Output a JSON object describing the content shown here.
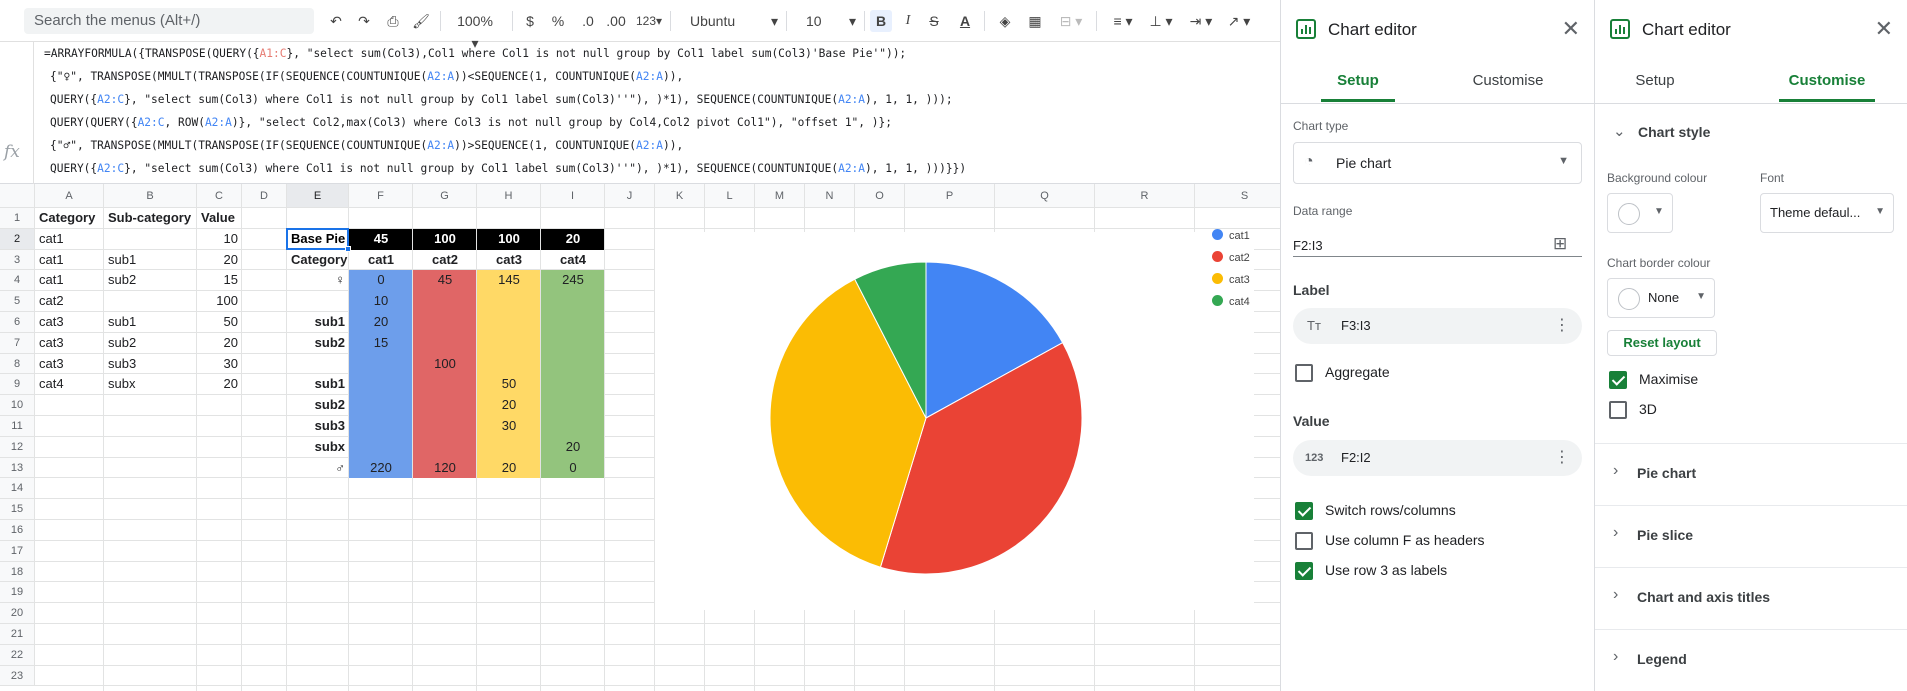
{
  "toolbar": {
    "search_placeholder": "Search the menus (Alt+/)",
    "zoom": "100%",
    "currency": "$",
    "percent": "%",
    "dec_less": ".0",
    "dec_more": ".00",
    "more_formats": "123",
    "font": "Ubuntu",
    "font_size": "10"
  },
  "formula": {
    "line1_a": "=ARRAYFORMULA({TRANSPOSE(QUERY({",
    "line1_ref": "A1:C",
    "line1_b": "}, \"select sum(Col3),Col1 where Col1 is not null group by Col1 label sum(Col3)'Base Pie'\"));",
    "line2_a": "{\"",
    "line2_sym": "♀",
    "line2_b": "\", TRANSPOSE(MMULT(TRANSPOSE(IF(SEQUENCE(COUNTUNIQUE(",
    "line2_ref1": "A2:A",
    "line2_c": "))<SEQUENCE(1, COUNTUNIQUE(",
    "line2_ref2": "A2:A",
    "line2_d": ")),",
    "line3_a": "QUERY({",
    "line3_ref": "A2:C",
    "line3_b": "}, \"select sum(Col3) where Col1 is not null group by Col1 label sum(Col3)''\"), )*1), SEQUENCE(COUNTUNIQUE(",
    "line3_ref2": "A2:A",
    "line3_c": "), 1, 1, )));",
    "line4_a": "QUERY(QUERY({",
    "line4_ref": "A2:C",
    "line4_b": ", ROW(",
    "line4_ref2": "A2:A",
    "line4_c": ")}, \"select Col2,max(Col3) where Col3 is not null group by Col4,Col2 pivot Col1\"), \"offset 1\", )};",
    "line5_a": "{\"",
    "line5_sym": "♂",
    "line5_b": "\", TRANSPOSE(MMULT(TRANSPOSE(IF(SEQUENCE(COUNTUNIQUE(",
    "line5_ref1": "A2:A",
    "line5_c": "))>SEQUENCE(1, COUNTUNIQUE(",
    "line5_ref2": "A2:A",
    "line5_d": ")),",
    "line6_a": "QUERY({",
    "line6_ref": "A2:C",
    "line6_b": "}, \"select sum(Col3) where Col1 is not null group by Col1 label sum(Col3)''\"), )*1), SEQUENCE(COUNTUNIQUE(",
    "line6_ref2": "A2:A",
    "line6_c": "), 1, 1, )))}})"
  },
  "grid": {
    "columns": [
      "A",
      "B",
      "C",
      "D",
      "E",
      "F",
      "G",
      "H",
      "I",
      "J",
      "K",
      "L",
      "M",
      "N",
      "O",
      "P",
      "Q",
      "R",
      "S"
    ],
    "rows": [
      "1",
      "2",
      "3",
      "4",
      "5",
      "6",
      "7",
      "8",
      "9",
      "10",
      "11",
      "12",
      "13",
      "14",
      "15",
      "16",
      "17",
      "18",
      "19",
      "20",
      "21",
      "22",
      "23"
    ],
    "a": [
      "Category",
      "cat1",
      "cat1",
      "cat1",
      "cat2",
      "cat3",
      "cat3",
      "cat3",
      "cat4"
    ],
    "b": [
      "Sub-category",
      "",
      "sub1",
      "sub2",
      "",
      "sub1",
      "sub2",
      "sub3",
      "subx"
    ],
    "c": [
      "Value",
      "10",
      "20",
      "15",
      "100",
      "50",
      "20",
      "30",
      "20"
    ],
    "e": [
      "Base Pie",
      "Category",
      "♀",
      "",
      "sub1",
      "sub2",
      "",
      "sub1",
      "sub2",
      "sub3",
      "subx",
      "♂"
    ],
    "f": [
      "45",
      "cat1",
      "0",
      "10",
      "20",
      "15",
      "",
      "",
      "",
      "",
      "",
      "220"
    ],
    "g": [
      "100",
      "cat2",
      "45",
      "",
      "",
      "",
      "100",
      "",
      "",
      "",
      "",
      "120"
    ],
    "h": [
      "100",
      "cat3",
      "145",
      "",
      "",
      "",
      "",
      "50",
      "20",
      "30",
      "",
      "20"
    ],
    "i": [
      "20",
      "cat4",
      "245",
      "",
      "",
      "",
      "",
      "",
      "",
      "",
      "20",
      "0"
    ]
  },
  "colors": {
    "blue": "#4285f4",
    "red": "#ea4335",
    "yellow": "#fbbc04",
    "green": "#34a853",
    "accent": "#188038"
  },
  "chart_data": {
    "type": "pie",
    "categories": [
      "cat1",
      "cat2",
      "cat3",
      "cat4"
    ],
    "values": [
      45,
      100,
      100,
      20
    ],
    "legend_position": "right"
  },
  "editor_setup": {
    "title": "Chart editor",
    "tab_setup": "Setup",
    "tab_customise": "Customise",
    "chart_type_label": "Chart type",
    "chart_type_value": "Pie chart",
    "data_range_label": "Data range",
    "data_range_value": "F2:I3",
    "label_section": "Label",
    "label_value": "F3:I3",
    "aggregate": "Aggregate",
    "value_section": "Value",
    "value_value": "F2:I2",
    "switch_rows": "Switch rows/columns",
    "use_col_headers": "Use column F as headers",
    "use_row_labels": "Use row 3 as labels"
  },
  "editor_customise": {
    "title": "Chart editor",
    "tab_setup": "Setup",
    "tab_customise": "Customise",
    "chart_style": "Chart style",
    "bg_colour_label": "Background colour",
    "font_label": "Font",
    "font_value": "Theme defaul...",
    "border_colour_label": "Chart border colour",
    "border_value": "None",
    "reset_layout": "Reset layout",
    "maximise": "Maximise",
    "threed": "3D",
    "sections": [
      "Pie chart",
      "Pie slice",
      "Chart and axis titles",
      "Legend"
    ]
  }
}
